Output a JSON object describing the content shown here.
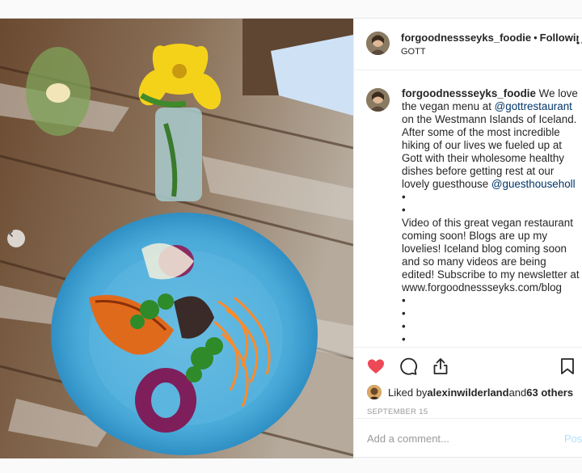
{
  "post": {
    "username": "forgoodnessseyks_foodie",
    "follow_state": "Following",
    "location": "GOTT",
    "caption": {
      "part1": " We love the vegan menu at ",
      "mention1": "@gottrestaurant",
      "part2": " on the Westmann Islands of Iceland. After some of the most incredible hiking of our lives we fueled up at Gott with their wholesome healthy dishes before getting rest at our lovely guesthouse ",
      "mention2": "@guesthouseholl",
      "part3": " •",
      "bullet": "•",
      "part4": "Video of this great vegan restaurant coming soon! Blogs are up my lovelies! Iceland blog coming soon and so many videos are being edited! Subscribe to my newsletter at www.forgoodnessseyks.com/blog"
    },
    "liked_by_prefix": "Liked by ",
    "liked_by_user": "alexinwilderland",
    "liked_by_and": " and ",
    "liked_by_others": "63 others",
    "date": "SEPTEMBER 15",
    "comment_placeholder": "Add a comment...",
    "post_button": "Post"
  },
  "icons": {
    "like": "heart-icon",
    "comment": "comment-icon",
    "share": "share-icon",
    "save": "bookmark-icon",
    "more": "more-icon",
    "prev": "chevron-left-icon"
  },
  "colors": {
    "like_red": "#ed4956",
    "link_blue": "#003569",
    "post_button": "#b2dffc"
  }
}
